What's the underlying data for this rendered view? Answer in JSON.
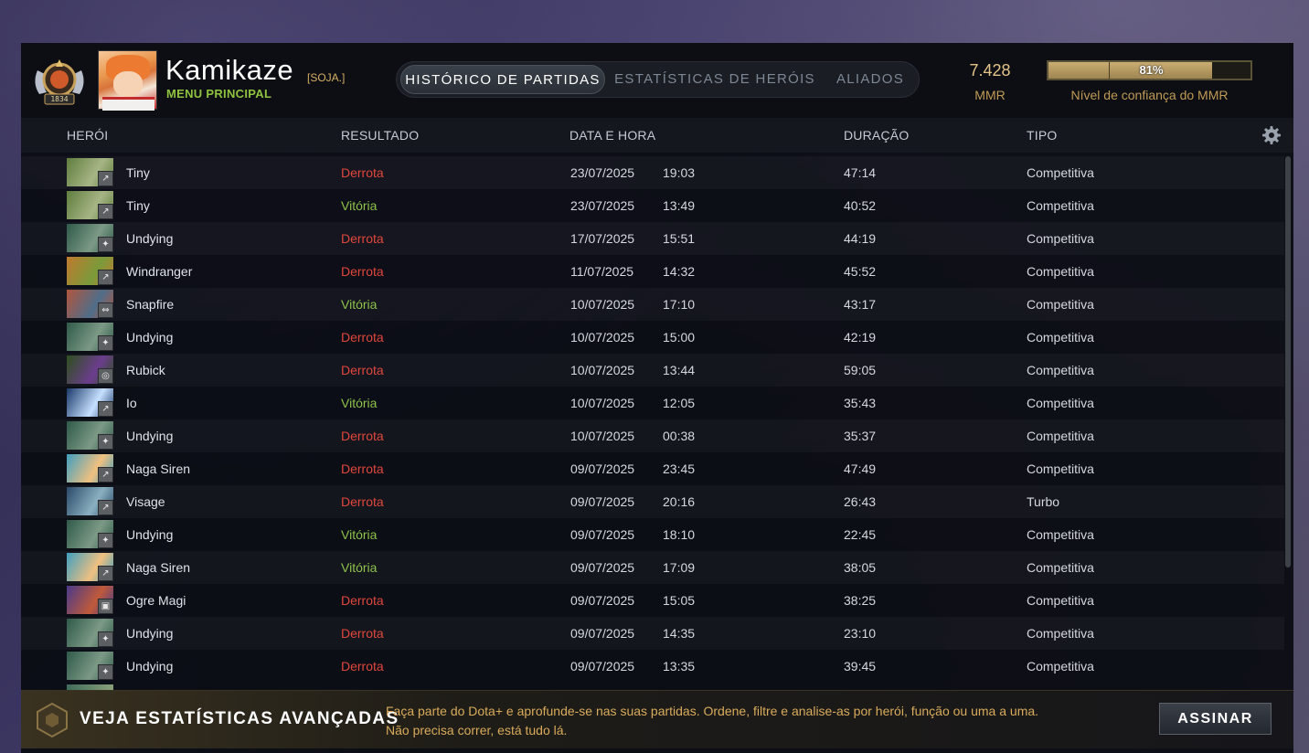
{
  "profile": {
    "name": "Kamikaze",
    "clan_tag": "[SOJA.]",
    "menu_link": "MENU PRINCIPAL",
    "rank_number": "1834"
  },
  "tabs": [
    {
      "label": "HISTÓRICO DE PARTIDAS",
      "active": true
    },
    {
      "label": "ESTATÍSTICAS DE HERÓIS",
      "active": false
    },
    {
      "label": "ALIADOS",
      "active": false
    }
  ],
  "mmr": {
    "value": "7.428",
    "label": "MMR",
    "confidence_text": "81%",
    "confidence_fraction": 0.81,
    "confidence_label": "Nível de confiança do MMR"
  },
  "table": {
    "headers": {
      "hero": "HERÓI",
      "result": "RESULTADO",
      "datetime": "DATA E HORA",
      "duration": "DURAÇÃO",
      "type": "TIPO"
    },
    "rows": [
      {
        "hero": "Tiny",
        "result": "Derrota",
        "win": false,
        "date": "23/07/2025",
        "time": "19:03",
        "duration": "47:14",
        "type": "Competitiva",
        "colors": [
          "#5f7d3e",
          "#a7b585"
        ],
        "role_icon": "lane-icon"
      },
      {
        "hero": "Tiny",
        "result": "Vitória",
        "win": true,
        "date": "23/07/2025",
        "time": "13:49",
        "duration": "40:52",
        "type": "Competitiva",
        "colors": [
          "#5f7d3e",
          "#a7b585"
        ],
        "role_icon": "lane-icon"
      },
      {
        "hero": "Undying",
        "result": "Derrota",
        "win": false,
        "date": "17/07/2025",
        "time": "15:51",
        "duration": "44:19",
        "type": "Competitiva",
        "colors": [
          "#2f5a4a",
          "#7c9a86"
        ],
        "role_icon": "support-icon"
      },
      {
        "hero": "Windranger",
        "result": "Derrota",
        "win": false,
        "date": "11/07/2025",
        "time": "14:32",
        "duration": "45:52",
        "type": "Competitiva",
        "colors": [
          "#c07a2e",
          "#7a9a3a"
        ],
        "role_icon": "lane-icon"
      },
      {
        "hero": "Snapfire",
        "result": "Vitória",
        "win": true,
        "date": "10/07/2025",
        "time": "17:10",
        "duration": "43:17",
        "type": "Competitiva",
        "colors": [
          "#b2553d",
          "#4f6e8a"
        ],
        "role_icon": "offlane-icon"
      },
      {
        "hero": "Undying",
        "result": "Derrota",
        "win": false,
        "date": "10/07/2025",
        "time": "15:00",
        "duration": "42:19",
        "type": "Competitiva",
        "colors": [
          "#2f5a4a",
          "#7c9a86"
        ],
        "role_icon": "support-icon"
      },
      {
        "hero": "Rubick",
        "result": "Derrota",
        "win": false,
        "date": "10/07/2025",
        "time": "13:44",
        "duration": "59:05",
        "type": "Competitiva",
        "colors": [
          "#2d4f1d",
          "#6c3d8e"
        ],
        "role_icon": "roam-icon"
      },
      {
        "hero": "Io",
        "result": "Vitória",
        "win": true,
        "date": "10/07/2025",
        "time": "12:05",
        "duration": "35:43",
        "type": "Competitiva",
        "colors": [
          "#1a3a6a",
          "#c6e0ff"
        ],
        "role_icon": "lane-icon"
      },
      {
        "hero": "Undying",
        "result": "Derrota",
        "win": false,
        "date": "10/07/2025",
        "time": "00:38",
        "duration": "35:37",
        "type": "Competitiva",
        "colors": [
          "#2f5a4a",
          "#7c9a86"
        ],
        "role_icon": "support-icon"
      },
      {
        "hero": "Naga Siren",
        "result": "Derrota",
        "win": false,
        "date": "09/07/2025",
        "time": "23:45",
        "duration": "47:49",
        "type": "Competitiva",
        "colors": [
          "#3f9fbf",
          "#f0c080"
        ],
        "role_icon": "lane-icon"
      },
      {
        "hero": "Visage",
        "result": "Derrota",
        "win": false,
        "date": "09/07/2025",
        "time": "20:16",
        "duration": "26:43",
        "type": "Turbo",
        "colors": [
          "#2a4a6a",
          "#8ab0c0"
        ],
        "role_icon": "lane-icon"
      },
      {
        "hero": "Undying",
        "result": "Vitória",
        "win": true,
        "date": "09/07/2025",
        "time": "18:10",
        "duration": "22:45",
        "type": "Competitiva",
        "colors": [
          "#2f5a4a",
          "#7c9a86"
        ],
        "role_icon": "support-icon"
      },
      {
        "hero": "Naga Siren",
        "result": "Vitória",
        "win": true,
        "date": "09/07/2025",
        "time": "17:09",
        "duration": "38:05",
        "type": "Competitiva",
        "colors": [
          "#3f9fbf",
          "#f0c080"
        ],
        "role_icon": "lane-icon"
      },
      {
        "hero": "Ogre Magi",
        "result": "Derrota",
        "win": false,
        "date": "09/07/2025",
        "time": "15:05",
        "duration": "38:25",
        "type": "Competitiva",
        "colors": [
          "#4a3a8a",
          "#c05a3a"
        ],
        "role_icon": "safe-icon"
      },
      {
        "hero": "Undying",
        "result": "Derrota",
        "win": false,
        "date": "09/07/2025",
        "time": "14:35",
        "duration": "23:10",
        "type": "Competitiva",
        "colors": [
          "#2f5a4a",
          "#7c9a86"
        ],
        "role_icon": "support-icon"
      },
      {
        "hero": "Undying",
        "result": "Derrota",
        "win": false,
        "date": "09/07/2025",
        "time": "13:35",
        "duration": "39:45",
        "type": "Competitiva",
        "colors": [
          "#2f5a4a",
          "#7c9a86"
        ],
        "role_icon": "support-icon"
      }
    ]
  },
  "footer": {
    "title": "VEJA ESTATÍSTICAS AVANÇADAS",
    "desc_line1": "Faça parte do Dota+ e aprofunde-se nas suas partidas. Ordene, filtre e analise-as por herói, função ou uma a uma.",
    "desc_line2": "Não precisa correr, está tudo lá.",
    "button": "ASSINAR"
  },
  "colors": {
    "win": "#8dc04a",
    "loss": "#e0473c",
    "gold": "#c09a55",
    "menu_green": "#8fc33f"
  }
}
